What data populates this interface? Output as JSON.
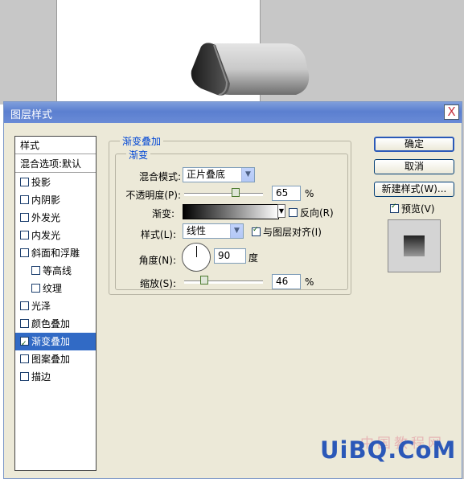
{
  "dialog": {
    "title": "图层样式",
    "close_glyph": "X"
  },
  "left_panel": {
    "header": "样式",
    "blend_options": "混合选项:默认",
    "items": [
      {
        "label": "投影",
        "checked": false,
        "indent": false,
        "selected": false
      },
      {
        "label": "内阴影",
        "checked": false,
        "indent": false,
        "selected": false
      },
      {
        "label": "外发光",
        "checked": false,
        "indent": false,
        "selected": false
      },
      {
        "label": "内发光",
        "checked": false,
        "indent": false,
        "selected": false
      },
      {
        "label": "斜面和浮雕",
        "checked": false,
        "indent": false,
        "selected": false
      },
      {
        "label": "等高线",
        "checked": false,
        "indent": true,
        "selected": false
      },
      {
        "label": "纹理",
        "checked": false,
        "indent": true,
        "selected": false
      },
      {
        "label": "光泽",
        "checked": false,
        "indent": false,
        "selected": false
      },
      {
        "label": "颜色叠加",
        "checked": false,
        "indent": false,
        "selected": false
      },
      {
        "label": "渐变叠加",
        "checked": true,
        "indent": false,
        "selected": true
      },
      {
        "label": "图案叠加",
        "checked": false,
        "indent": false,
        "selected": false
      },
      {
        "label": "描边",
        "checked": false,
        "indent": false,
        "selected": false
      }
    ]
  },
  "gradient_overlay": {
    "section_title": "渐变叠加",
    "group_title": "渐变",
    "blend_mode_label": "混合模式:",
    "blend_mode_value": "正片叠底",
    "opacity_label": "不透明度(P):",
    "opacity_value": "65",
    "opacity_level": 0.65,
    "percent": "%",
    "gradient_label": "渐变:",
    "reverse_label": "反向(R)",
    "reverse_checked": false,
    "style_label": "样式(L):",
    "style_value": "线性",
    "align_label": "与图层对齐(I)",
    "align_checked": true,
    "angle_label": "角度(N):",
    "angle_value": "90",
    "angle_unit": "度",
    "scale_label": "缩放(S):",
    "scale_value": "46",
    "scale_level": 0.46
  },
  "buttons": {
    "ok": "确定",
    "cancel": "取消",
    "new_style": "新建样式(W)...",
    "preview_label": "预览(V)",
    "preview_checked": true
  },
  "watermark": {
    "text": "UiBQ.CoM",
    "cn": "中国教程网"
  }
}
